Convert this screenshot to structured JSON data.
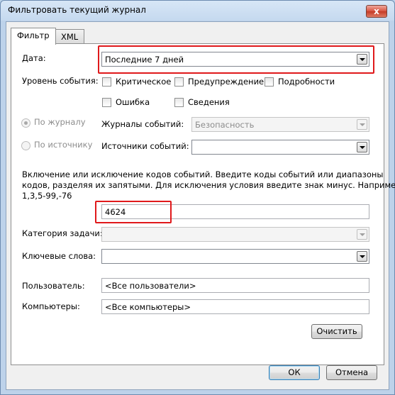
{
  "window": {
    "title": "Фильтровать текущий журнал",
    "close_glyph": "x"
  },
  "tabs": [
    {
      "label": "Фильтр",
      "active": true
    },
    {
      "label": "XML",
      "active": false
    }
  ],
  "filter": {
    "date": {
      "label": "Дата:",
      "value": "Последние 7 дней"
    },
    "level": {
      "label": "Уровень события:",
      "options": [
        {
          "label": "Критическое",
          "checked": false
        },
        {
          "label": "Предупреждение",
          "checked": false
        },
        {
          "label": "Подробности",
          "checked": false
        },
        {
          "label": "Ошибка",
          "checked": false
        },
        {
          "label": "Сведения",
          "checked": false
        }
      ]
    },
    "by_log": {
      "label": "По журналу",
      "selected": true
    },
    "by_source": {
      "label": "По источнику",
      "selected": false
    },
    "event_logs": {
      "label": "Журналы событий:",
      "value": "Безопасность"
    },
    "event_sources": {
      "label": "Источники событий:",
      "value": ""
    },
    "description": {
      "line1": "Включение или исключение кодов событий. Введите коды событий или диапазоны",
      "line2": "кодов, разделяя их запятыми. Для исключения условия введите знак минус. Например:",
      "line3": "1,3,5-99,-76"
    },
    "event_ids": {
      "value": "4624"
    },
    "task_category": {
      "label": "Категория задачи:",
      "value": ""
    },
    "keywords": {
      "label": "Ключевые слова:",
      "value": ""
    },
    "user": {
      "label": "Пользователь:",
      "value": "<Все пользователи>"
    },
    "computers": {
      "label": "Компьютеры:",
      "value": "<Все компьютеры>"
    },
    "clear_label": "Очистить"
  },
  "footer": {
    "ok_label": "ОК",
    "cancel_label": "Отмена"
  },
  "colors": {
    "highlight": "#e0191b"
  }
}
